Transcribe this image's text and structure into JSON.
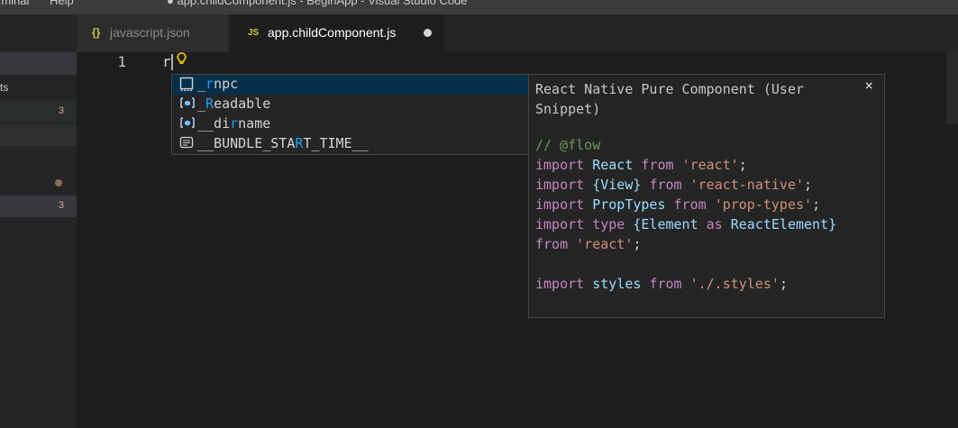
{
  "titlebar": {
    "menu": [
      "rminal",
      "Help"
    ],
    "window_title": "● app.childComponent.js - BeginApp - Visual Studio Code"
  },
  "sidebar": {
    "rows": [
      {
        "label": "ts",
        "badge": "",
        "dot": false,
        "highlight": false
      },
      {
        "label": "",
        "badge": "3",
        "dot": false,
        "highlight": true
      },
      {
        "label": "",
        "badge": "",
        "dot": true,
        "highlight": false
      },
      {
        "label": "",
        "badge": "3",
        "dot": false,
        "highlight": true
      }
    ]
  },
  "tabs": [
    {
      "icon": "{}",
      "name": "javascript.json",
      "active": false,
      "modified": false
    },
    {
      "icon": "JS",
      "name": "app.childComponent.js",
      "active": true,
      "modified": true
    }
  ],
  "editor": {
    "line_number": "1",
    "typed_text": "r"
  },
  "suggestions": [
    {
      "icon": "snippet-icon",
      "before": "_",
      "match": "r",
      "after": "npc",
      "selected": true
    },
    {
      "icon": "variable-icon",
      "before": "_",
      "match": "R",
      "after": "eadable",
      "selected": false
    },
    {
      "icon": "variable-icon",
      "before": "__di",
      "match": "r",
      "after": "name",
      "selected": false
    },
    {
      "icon": "text-icon",
      "before": "__BUNDLE_STA",
      "match": "R",
      "after": "T_TIME__",
      "selected": false
    }
  ],
  "docs": {
    "title": "React Native Pure Component (User Snippet)",
    "close": "×",
    "code_lines": [
      [
        {
          "t": "// @flow",
          "c": "cmt"
        }
      ],
      [
        {
          "t": "import ",
          "c": "kw"
        },
        {
          "t": "React ",
          "c": "id"
        },
        {
          "t": "from ",
          "c": "kw"
        },
        {
          "t": "'react'",
          "c": "str"
        },
        {
          "t": ";",
          "c": "pl"
        }
      ],
      [
        {
          "t": "import ",
          "c": "kw"
        },
        {
          "t": "{View} ",
          "c": "id"
        },
        {
          "t": "from ",
          "c": "kw"
        },
        {
          "t": "'react-native'",
          "c": "str"
        },
        {
          "t": ";",
          "c": "pl"
        }
      ],
      [
        {
          "t": "import ",
          "c": "kw"
        },
        {
          "t": "PropTypes ",
          "c": "id"
        },
        {
          "t": "from ",
          "c": "kw"
        },
        {
          "t": "'prop-types'",
          "c": "str"
        },
        {
          "t": ";",
          "c": "pl"
        }
      ],
      [
        {
          "t": "import ",
          "c": "kw"
        },
        {
          "t": "type ",
          "c": "kw"
        },
        {
          "t": "{Element ",
          "c": "id"
        },
        {
          "t": "as ",
          "c": "kw"
        },
        {
          "t": "ReactElement}",
          "c": "id"
        }
      ],
      [
        {
          "t": "from ",
          "c": "kw"
        },
        {
          "t": "'react'",
          "c": "str"
        },
        {
          "t": ";",
          "c": "pl"
        }
      ],
      [
        {
          "t": "",
          "c": "pl"
        }
      ],
      [
        {
          "t": "import ",
          "c": "kw"
        },
        {
          "t": "styles ",
          "c": "id"
        },
        {
          "t": "from ",
          "c": "kw"
        },
        {
          "t": "'./.styles'",
          "c": "str"
        },
        {
          "t": ";",
          "c": "pl"
        }
      ]
    ]
  }
}
